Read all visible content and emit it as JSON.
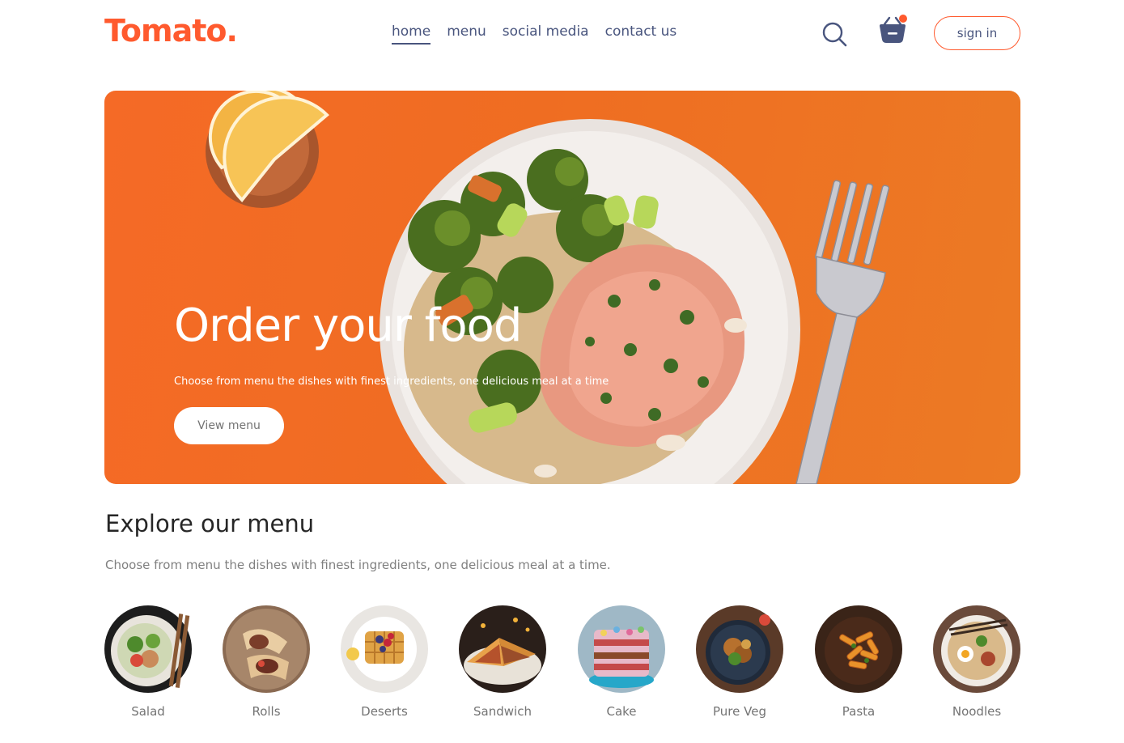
{
  "navbar": {
    "logo": "Tomato.",
    "links": [
      "home",
      "menu",
      "social media",
      "contact us"
    ],
    "active_link": "home",
    "search_icon": "search-icon",
    "basket_icon": "basket-icon",
    "signin_label": "sign in"
  },
  "hero": {
    "title": "Order your food",
    "subtitle": "Choose from menu the dishes with finest ingredients, one delicious meal at a time",
    "button_label": "View menu"
  },
  "explore": {
    "title": "Explore our menu",
    "subtitle": "Choose from menu the dishes with finest ingredients, one delicious meal at a time.",
    "items": [
      {
        "name": "Salad"
      },
      {
        "name": "Rolls"
      },
      {
        "name": "Deserts"
      },
      {
        "name": "Sandwich"
      },
      {
        "name": "Cake"
      },
      {
        "name": "Pure Veg"
      },
      {
        "name": "Pasta"
      },
      {
        "name": "Noodles"
      }
    ]
  },
  "colors": {
    "brand": "#ff5a2e",
    "nav_text": "#49557e",
    "hero_bg": "#ef6d22"
  }
}
